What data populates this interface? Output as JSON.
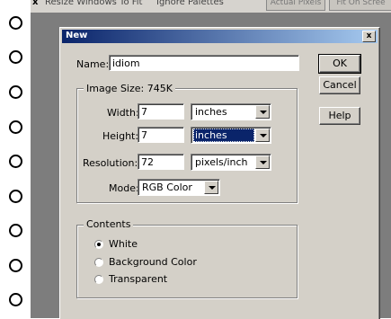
{
  "toolbar": {
    "text_left": "x",
    "item1": "Resize Windows To Fit",
    "item2": "Ignore Palettes",
    "btn1": "Actual Pixels",
    "btn2": "Fit On Scree"
  },
  "dialog": {
    "title": "New",
    "close_label": "x",
    "name_label": "Name:",
    "name_value": "idiom",
    "image_size_label": "Image Size:",
    "image_size_value": "745K",
    "width_label": "Width:",
    "width_value": "7",
    "width_unit": "inches",
    "height_label": "Height:",
    "height_value": "7",
    "height_unit": "inches",
    "resolution_label": "Resolution:",
    "resolution_value": "72",
    "resolution_unit": "pixels/inch",
    "mode_label": "Mode:",
    "mode_value": "RGB Color",
    "contents_label": "Contents",
    "contents_options": [
      "White",
      "Background Color",
      "Transparent"
    ],
    "contents_selected": "White",
    "ok_label": "OK",
    "cancel_label": "Cancel",
    "help_label": "Help"
  },
  "icons": {
    "dropdown": "chevron-down-icon",
    "close": "close-icon",
    "ring": "notebook-ring-icon"
  },
  "colors": {
    "titlebar_start": "#0a246a",
    "titlebar_end": "#a6caf0",
    "dialog_bg": "#d4d0c8",
    "workspace_bg": "#7d7d7d"
  }
}
